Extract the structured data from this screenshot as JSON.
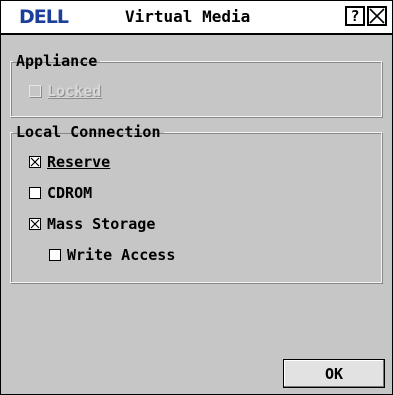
{
  "window": {
    "logo": "DELL",
    "title": "Virtual Media",
    "help_label": "?",
    "close_icon": "close-icon"
  },
  "appliance": {
    "legend": "Appliance",
    "locked": {
      "label": "Locked",
      "checked": false,
      "enabled": false
    }
  },
  "local_connection": {
    "legend": "Local Connection",
    "reserve": {
      "label": "Reserve",
      "checked": true
    },
    "cdrom": {
      "label": "CDROM",
      "checked": false
    },
    "mass_storage": {
      "label": "Mass Storage",
      "checked": true
    },
    "write_access": {
      "label": "Write Access",
      "checked": false
    }
  },
  "buttons": {
    "ok_label": "OK"
  },
  "colors": {
    "logo": "#1c3f9c",
    "dialog_bg": "#c6c6c6",
    "ok_bg": "#e2e2e2"
  }
}
